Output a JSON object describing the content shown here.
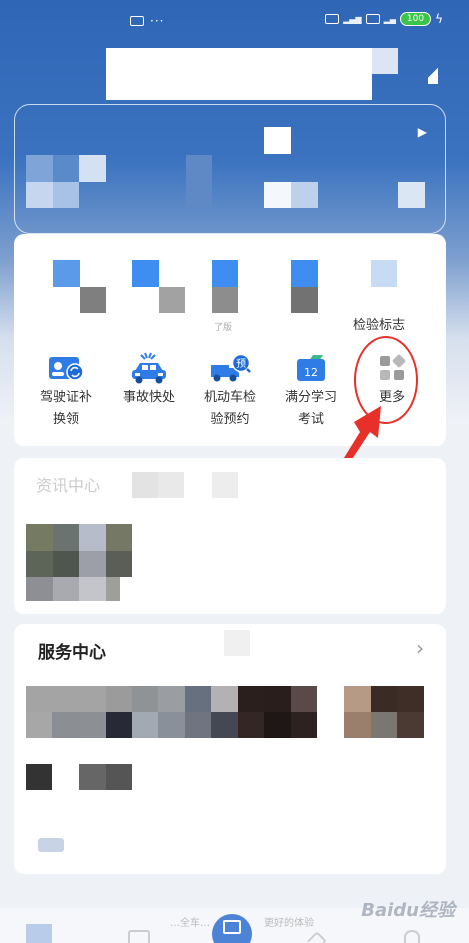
{
  "status_bar": {
    "dots": "···",
    "battery": "100"
  },
  "services_top": {
    "inspection_label": "检验标志",
    "faded_text": "了版"
  },
  "services": [
    {
      "line1": "驾驶证补",
      "line2": "换领",
      "icon": "id-card-swap-icon"
    },
    {
      "line1": "事故快处",
      "line2": "",
      "icon": "car-accident-icon"
    },
    {
      "line1": "机动车检",
      "line2": "验预约",
      "icon": "truck-appointment-icon"
    },
    {
      "line1": "满分学习",
      "line2": "考试",
      "icon": "calendar-exam-icon"
    },
    {
      "line1": "更多",
      "line2": "",
      "icon": "grid-more-icon"
    }
  ],
  "calendar_number": "12",
  "appointment_badge": "预",
  "news": {
    "title": "资讯中心"
  },
  "service_center": {
    "title": "服务中心",
    "chevron": "›"
  },
  "bottom_nav": {
    "text_left": "…全车…",
    "text_right": "更好的体验"
  },
  "watermark": "Baidu经验",
  "colors": {
    "accent_blue": "#2f66b6",
    "highlight_red": "#e8302b"
  }
}
